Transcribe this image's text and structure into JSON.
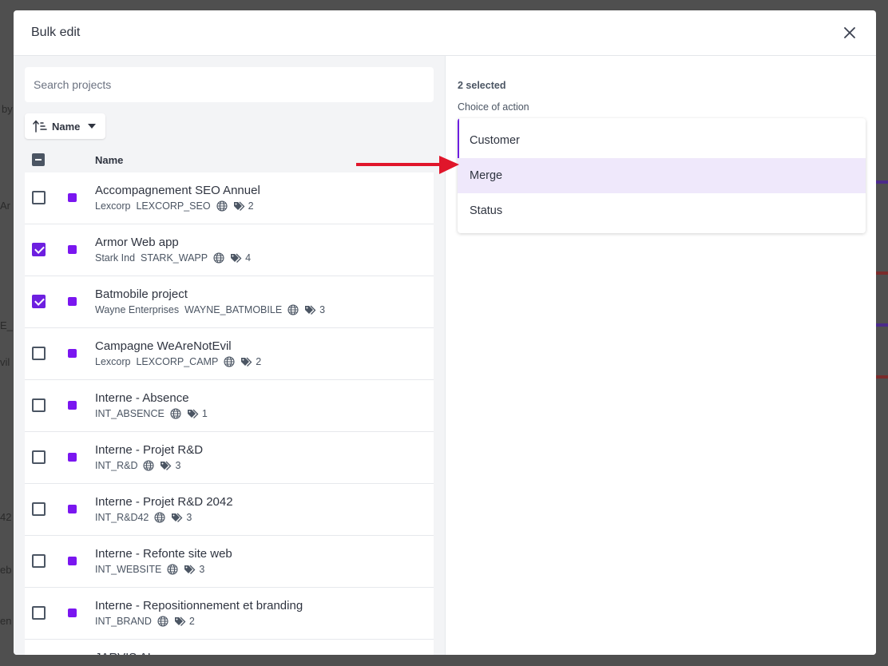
{
  "modal": {
    "title": "Bulk edit"
  },
  "search": {
    "placeholder": "Search projects"
  },
  "sort": {
    "label": "Name"
  },
  "list_header": {
    "name": "Name"
  },
  "projects": [
    {
      "title": "Accompagnement SEO Annuel",
      "client": "Lexcorp",
      "code": "LEXCORP_SEO",
      "tags": "2",
      "checked": false
    },
    {
      "title": "Armor Web app",
      "client": "Stark Ind",
      "code": "STARK_WAPP",
      "tags": "4",
      "checked": true
    },
    {
      "title": "Batmobile project",
      "client": "Wayne Enterprises",
      "code": "WAYNE_BATMOBILE",
      "tags": "3",
      "checked": true
    },
    {
      "title": "Campagne WeAreNotEvil",
      "client": "Lexcorp",
      "code": "LEXCORP_CAMP",
      "tags": "2",
      "checked": false
    },
    {
      "title": "Interne - Absence",
      "client": "",
      "code": "INT_ABSENCE",
      "tags": "1",
      "checked": false
    },
    {
      "title": "Interne - Projet R&D",
      "client": "",
      "code": "INT_R&D",
      "tags": "3",
      "checked": false
    },
    {
      "title": "Interne - Projet R&D 2042",
      "client": "",
      "code": "INT_R&D42",
      "tags": "3",
      "checked": false
    },
    {
      "title": "Interne - Refonte site web",
      "client": "",
      "code": "INT_WEBSITE",
      "tags": "3",
      "checked": false
    },
    {
      "title": "Interne - Repositionnement et branding",
      "client": "",
      "code": "INT_BRAND",
      "tags": "2",
      "checked": false
    },
    {
      "title": "JARVIS AI",
      "client": "",
      "code": "",
      "tags": "",
      "checked": false
    }
  ],
  "action_panel": {
    "selected_count": "2 selected",
    "choice_label": "Choice of action",
    "options": [
      "Customer",
      "Merge",
      "Status"
    ],
    "highlighted": "Merge"
  },
  "colors": {
    "accent": "#6d1fe0",
    "project_dot": "#7a16f0",
    "highlight": "#efe8fb",
    "arrow": "#e0162b"
  },
  "icons": [
    "close-icon",
    "sort-icon",
    "caret-down-icon",
    "globe-icon",
    "tags-icon",
    "arrow-icon"
  ]
}
